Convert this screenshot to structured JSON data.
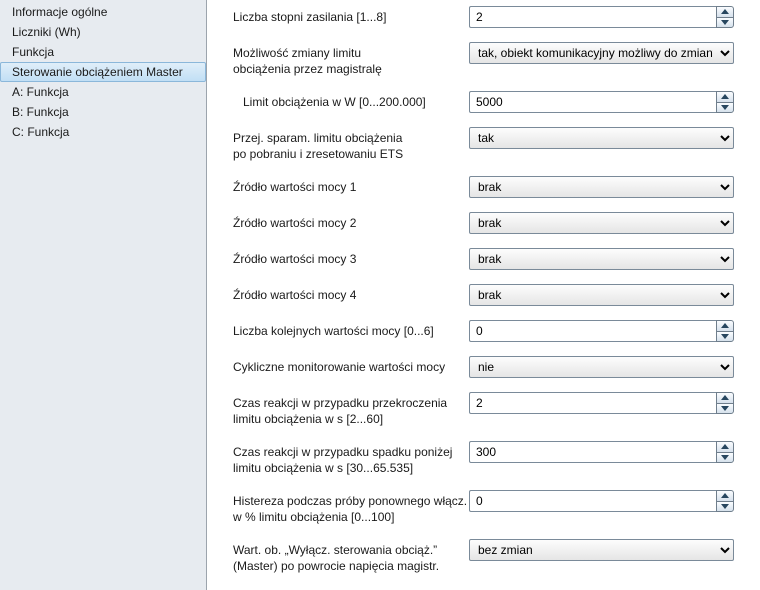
{
  "sidebar": {
    "items": [
      {
        "label": "Informacje ogólne",
        "selected": false
      },
      {
        "label": "Liczniki  (Wh)",
        "selected": false
      },
      {
        "label": "Funkcja",
        "selected": false
      },
      {
        "label": "Sterowanie obciążeniem Master",
        "selected": true
      },
      {
        "label": "A: Funkcja",
        "selected": false
      },
      {
        "label": "B: Funkcja",
        "selected": false
      },
      {
        "label": "C: Funkcja",
        "selected": false
      }
    ]
  },
  "params": {
    "p0": {
      "label": "Liczba stopni zasilania [1...8]",
      "value": "2",
      "type": "spin"
    },
    "p1": {
      "label": "Możliwość zmiany limitu\nobciążenia przez magistralę",
      "value": "tak, obiekt komunikacyjny możliwy do zmiany",
      "type": "combo"
    },
    "p2": {
      "label": "Limit obciążenia w W [0...200.000]",
      "value": "5000",
      "type": "spin",
      "sub": true
    },
    "p3": {
      "label": "Przej. sparam. limitu obciążenia\npo pobraniu i zresetowaniu ETS",
      "value": "tak",
      "type": "combo"
    },
    "p4": {
      "label": "Źródło wartości mocy 1",
      "value": "brak",
      "type": "combo"
    },
    "p5": {
      "label": "Źródło wartości mocy 2",
      "value": "brak",
      "type": "combo"
    },
    "p6": {
      "label": "Źródło wartości mocy 3",
      "value": "brak",
      "type": "combo"
    },
    "p7": {
      "label": "Źródło wartości mocy 4",
      "value": "brak",
      "type": "combo"
    },
    "p8": {
      "label": "Liczba kolejnych wartości mocy [0...6]",
      "value": "0",
      "type": "spin"
    },
    "p9": {
      "label": "Cykliczne monitorowanie wartości mocy",
      "value": "nie",
      "type": "combo"
    },
    "p10": {
      "label": "Czas reakcji w przypadku przekroczenia\nlimitu obciążenia w s [2...60]",
      "value": "2",
      "type": "spin"
    },
    "p11": {
      "label": "Czas reakcji w przypadku spadku poniżej\nlimitu obciążenia w s [30...65.535]",
      "value": "300",
      "type": "spin"
    },
    "p12": {
      "label": "Histereza podczas próby ponownego włącz.\nw % limitu obciążenia [0...100]",
      "value": "0",
      "type": "spin"
    },
    "p13": {
      "label": "Wart. ob. „Wyłącz. sterowania obciąż.”\n(Master) po powrocie napięcia magistr.",
      "value": "bez zmian",
      "type": "combo"
    }
  },
  "order": [
    "p0",
    "p1",
    "p2",
    "p3",
    "p4",
    "p5",
    "p6",
    "p7",
    "p8",
    "p9",
    "p10",
    "p11",
    "p12",
    "p13"
  ]
}
